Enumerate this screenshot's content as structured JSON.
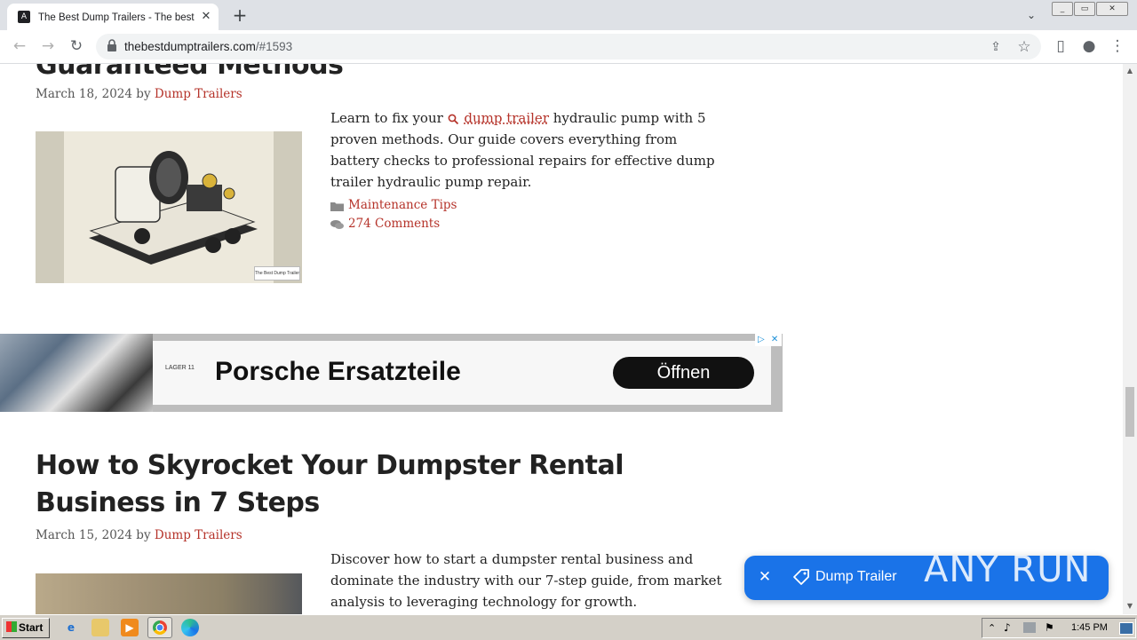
{
  "browser": {
    "tab_title": "The Best Dump Trailers - The best du",
    "url_host": "thebestdumptrailers.com",
    "url_path": "/#1593",
    "tab_favicon": "A",
    "tab_close": "✕",
    "newtab": "+",
    "tablist": "⌄",
    "back": "←",
    "forward": "→",
    "reload": "↻",
    "share": "⇪",
    "star": "☆",
    "sidepanel": "▯",
    "profile": "●",
    "menu": "⋮",
    "win_min": "_",
    "win_max": "▭",
    "win_close": "✕"
  },
  "post1": {
    "title": "Guaranteed Methods",
    "date": "March 18, 2024",
    "by": "by",
    "author": "Dump Trailers",
    "excerpt_before": "Learn to fix your",
    "keyword": "dump trailer",
    "excerpt_after": "hydraulic pump with 5 proven methods. Our guide covers everything from battery checks to professional repairs for effective dump trailer hydraulic pump repair.",
    "category": "Maintenance Tips",
    "comments": "274 Comments",
    "thumb_caption": "The Best Dump Trailer"
  },
  "ad": {
    "logo": "LAGER 11",
    "headline": "Porsche Ersatzteile",
    "button": "Öffnen",
    "choices_icon": "▷",
    "close_icon": "✕"
  },
  "post2": {
    "title": "How to Skyrocket Your Dumpster Rental Business in 7 Steps",
    "date": "March 15, 2024",
    "by": "by",
    "author": "Dump Trailers",
    "excerpt": "Discover how to start a dumpster rental business and dominate the industry with our 7-step guide, from market analysis to leveraging technology for growth."
  },
  "widget": {
    "close": "✕",
    "label": "Dump Trailer"
  },
  "watermark": "ANY RUN",
  "taskbar": {
    "start": "Start",
    "clock": "1:45 PM"
  },
  "colors": {
    "accent_link": "#b5332a",
    "widget_blue": "#1a73e8",
    "taskbar": "#d4d0c8"
  }
}
